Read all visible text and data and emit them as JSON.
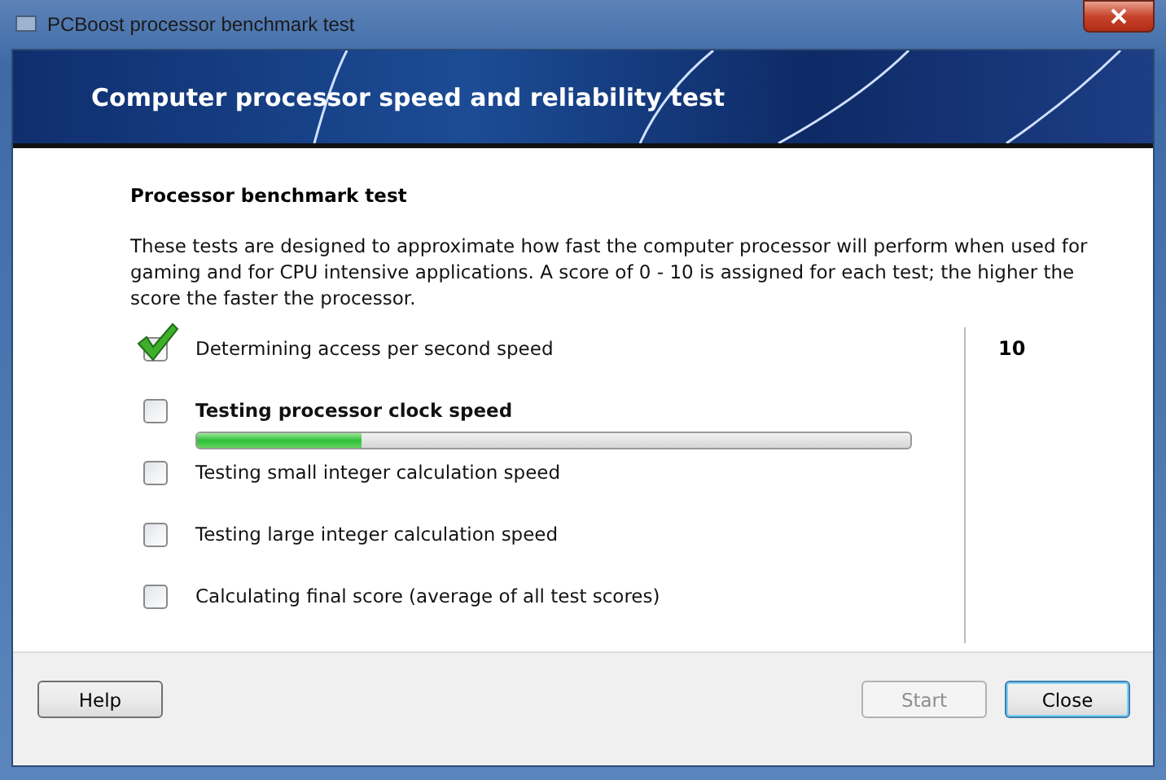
{
  "window": {
    "title": "PCBoost processor benchmark test"
  },
  "header": {
    "title": "Computer processor speed and reliability test"
  },
  "section": {
    "title": "Processor benchmark test",
    "description": "These tests are designed to approximate how fast the computer processor will perform when used for gaming and for CPU intensive applications.  A score of 0 - 10 is assigned for each test; the higher the score the faster the processor."
  },
  "tests": [
    {
      "label": "Determining access per second speed",
      "checked": true,
      "running": false,
      "score": "10"
    },
    {
      "label": "Testing processor clock speed",
      "checked": false,
      "running": true,
      "level": 0.23
    },
    {
      "label": "Testing small integer calculation speed",
      "checked": false,
      "running": false
    },
    {
      "label": "Testing large integer calculation speed",
      "checked": false,
      "running": false
    },
    {
      "label": "Calculating final score (average of all test scores)",
      "checked": false,
      "running": false
    }
  ],
  "buttons": [
    {
      "label": "Help",
      "disabled": false,
      "default": false
    },
    {
      "label": "Start",
      "disabled": true,
      "default": false
    },
    {
      "label": "Close",
      "disabled": false,
      "default": true
    }
  ]
}
